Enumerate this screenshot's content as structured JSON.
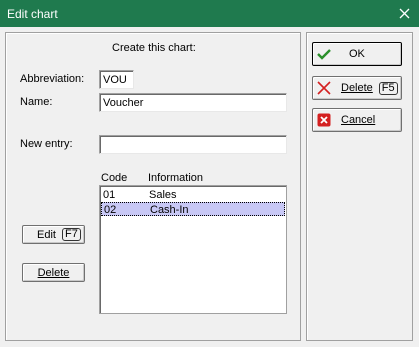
{
  "window": {
    "title": "Edit chart"
  },
  "form": {
    "heading": "Create this chart:",
    "abbreviation_label": "Abbreviation:",
    "abbreviation_value": "VOU",
    "name_label": "Name:",
    "name_value": "Voucher",
    "new_entry_label": "New entry:",
    "new_entry_value": ""
  },
  "list": {
    "columns": [
      "Code",
      "Information"
    ],
    "rows": [
      {
        "code": "01",
        "info": "Sales",
        "selected": false
      },
      {
        "code": "02",
        "info": "Cash-In",
        "selected": true
      }
    ]
  },
  "left_buttons": {
    "edit_label": "Edit",
    "edit_key": "F7",
    "delete_label": "Delete"
  },
  "right_buttons": {
    "ok_label": "OK",
    "delete_label": "Delete",
    "delete_key": "F5",
    "cancel_label": "Cancel"
  },
  "icons": {
    "close": "close-icon",
    "ok": "checkmark-icon",
    "delete": "x-icon",
    "cancel": "cancel-icon"
  },
  "colors": {
    "titlebar": "#1f7a4e",
    "selection": "#c8c8f5",
    "ok_check": "#2a8f2a",
    "delete_x": "#d42020",
    "cancel_red": "#d42020"
  }
}
